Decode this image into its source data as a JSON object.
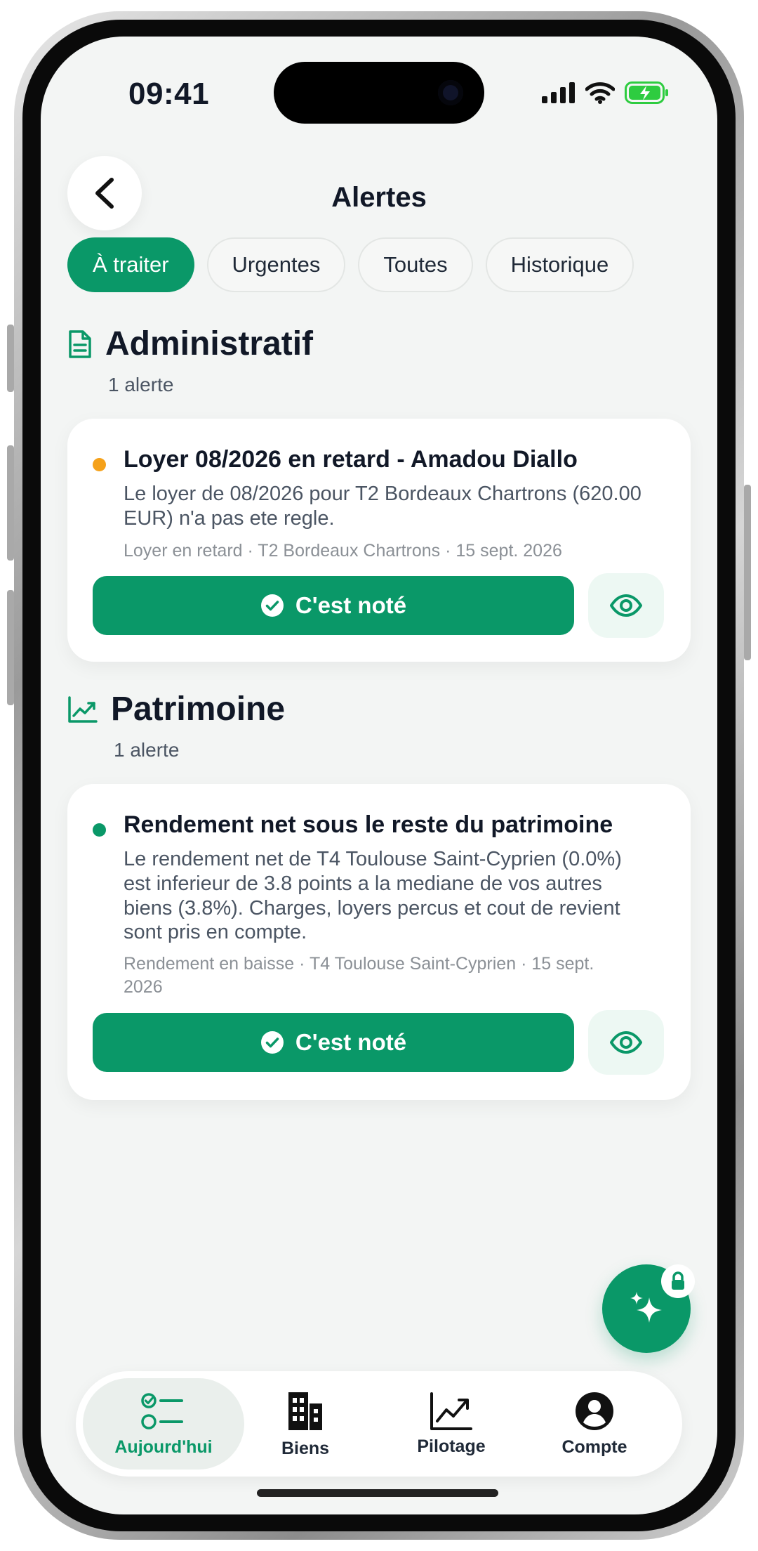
{
  "status_bar": {
    "time": "09:41"
  },
  "header": {
    "title": "Alertes",
    "back_icon": "chevron-left-icon"
  },
  "tabs": [
    {
      "label": "À traiter",
      "active": true
    },
    {
      "label": "Urgentes",
      "active": false
    },
    {
      "label": "Toutes",
      "active": false
    },
    {
      "label": "Historique",
      "active": false
    }
  ],
  "sections": [
    {
      "title": "Administratif",
      "count": "1 alerte",
      "icon": "document-icon",
      "alerts": [
        {
          "dot_color": "#f5a11a",
          "title": "Loyer 08/2026 en retard - Amadou Diallo",
          "body": "Le loyer de 08/2026 pour T2 Bordeaux Chartrons (620.00 EUR) n'a pas ete regle.",
          "meta": "Loyer en retard · T2 Bordeaux Chartrons · 15 sept. 2026",
          "ack_label": "C'est noté"
        }
      ]
    },
    {
      "title": "Patrimoine",
      "count": "1 alerte",
      "icon": "trending-up-icon",
      "alerts": [
        {
          "dot_color": "#0a9868",
          "title": "Rendement net sous le reste du patrimoine",
          "body": "Le rendement net de T4 Toulouse Saint-Cyprien (0.0%) est inferieur de 3.8 points a la mediane de vos autres biens (3.8%). Charges, loyers percus et cout de revient sont pris en compte.",
          "meta": "Rendement en baisse · T4 Toulouse Saint-Cyprien · 15 sept. 2026",
          "ack_label": "C'est noté"
        }
      ]
    }
  ],
  "bottom_nav": [
    {
      "label": "Aujourd'hui",
      "icon": "checklist-icon",
      "active": true
    },
    {
      "label": "Biens",
      "icon": "building-icon",
      "active": false
    },
    {
      "label": "Pilotage",
      "icon": "chart-line-icon",
      "active": false
    },
    {
      "label": "Compte",
      "icon": "account-icon",
      "active": false
    }
  ],
  "colors": {
    "accent": "#0a9868",
    "warning": "#f5a11a",
    "background": "#f3f5f4"
  }
}
